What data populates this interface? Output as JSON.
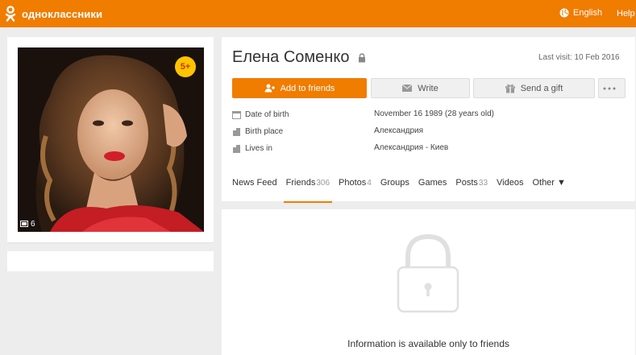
{
  "topbar": {
    "logo_text": "одноклассники",
    "language": "English",
    "help": "Help",
    "color": "#f07c00"
  },
  "photo": {
    "age_badge": "5+",
    "photo_count": "6"
  },
  "profile": {
    "name": "Елена Соменко",
    "last_visit": "Last visit: 10 Feb 2016",
    "buttons": {
      "add_friend": "Add to friends",
      "write": "Write",
      "gift": "Send a gift"
    },
    "info": {
      "birth_label": "Date of birth",
      "birth_value": "November 16 1989 (28 years old)",
      "birthplace_label": "Birth place",
      "birthplace_value": "Александрия",
      "lives_label": "Lives in",
      "lives_value": "Александрия - Киев"
    }
  },
  "tabs": [
    {
      "label": "News Feed",
      "count": ""
    },
    {
      "label": "Friends",
      "count": "306"
    },
    {
      "label": "Photos",
      "count": "4"
    },
    {
      "label": "Groups",
      "count": ""
    },
    {
      "label": "Games",
      "count": ""
    },
    {
      "label": "Posts",
      "count": "33"
    },
    {
      "label": "Videos",
      "count": ""
    },
    {
      "label": "Other ▼",
      "count": ""
    }
  ],
  "private_notice": "Information is available only to friends"
}
